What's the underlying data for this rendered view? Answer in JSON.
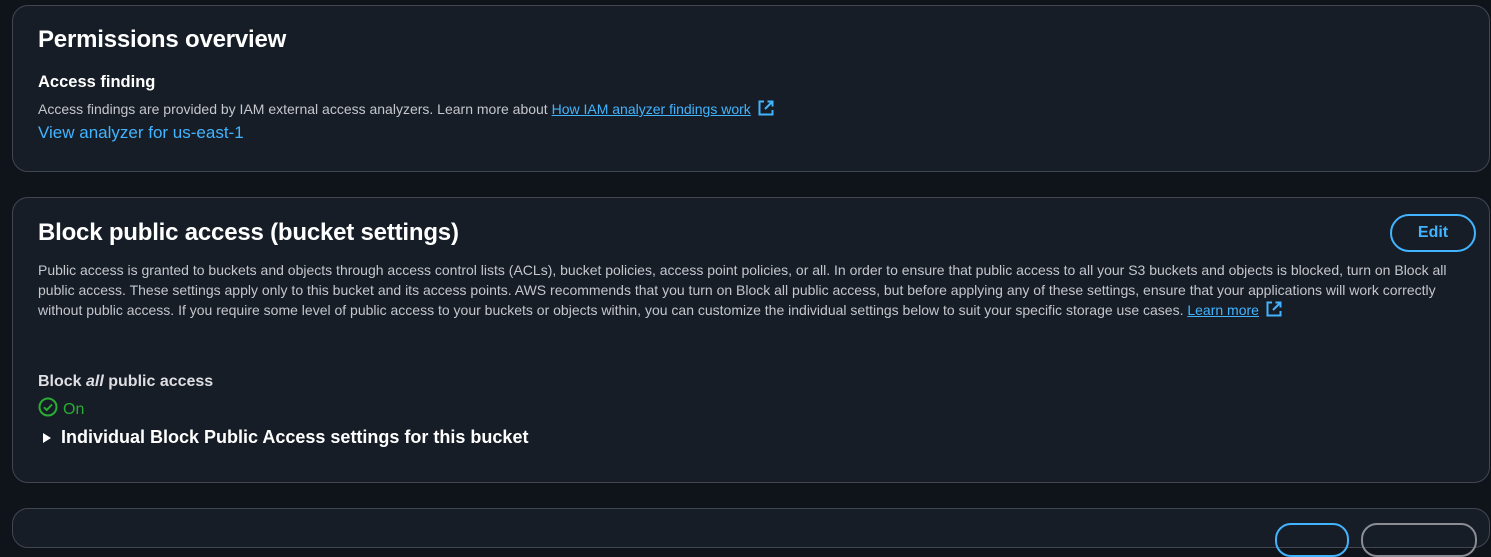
{
  "permissions_overview": {
    "title": "Permissions overview",
    "access_finding": {
      "heading": "Access finding",
      "description": "Access findings are provided by IAM external access analyzers. Learn more about ",
      "link_label": "How IAM analyzer findings work",
      "view_analyzer_label": "View analyzer for us-east-1"
    }
  },
  "block_public_access": {
    "title": "Block public access (bucket settings)",
    "edit_label": "Edit",
    "description": "Public access is granted to buckets and objects through access control lists (ACLs), bucket policies, access point policies, or all. In order to ensure that public access to all your S3 buckets and objects is blocked, turn on Block all public access. These settings apply only to this bucket and its access points. AWS recommends that you turn on Block all public access, but before applying any of these settings, ensure that your applications will work correctly without public access. If you require some level of public access to your buckets or objects within, you can customize the individual settings below to suit your specific storage use cases. ",
    "learn_more_label": "Learn more",
    "setting_label_prefix": "Block ",
    "setting_label_emphasis": "all",
    "setting_label_suffix": " public access",
    "status_value": "On",
    "status_icon": "check-circle-icon",
    "expander_label": "Individual Block Public Access settings for this bucket"
  },
  "colors": {
    "link": "#42b4ff",
    "success": "#29ad32",
    "panel_bg": "#161d26",
    "page_bg": "#0f141a"
  }
}
